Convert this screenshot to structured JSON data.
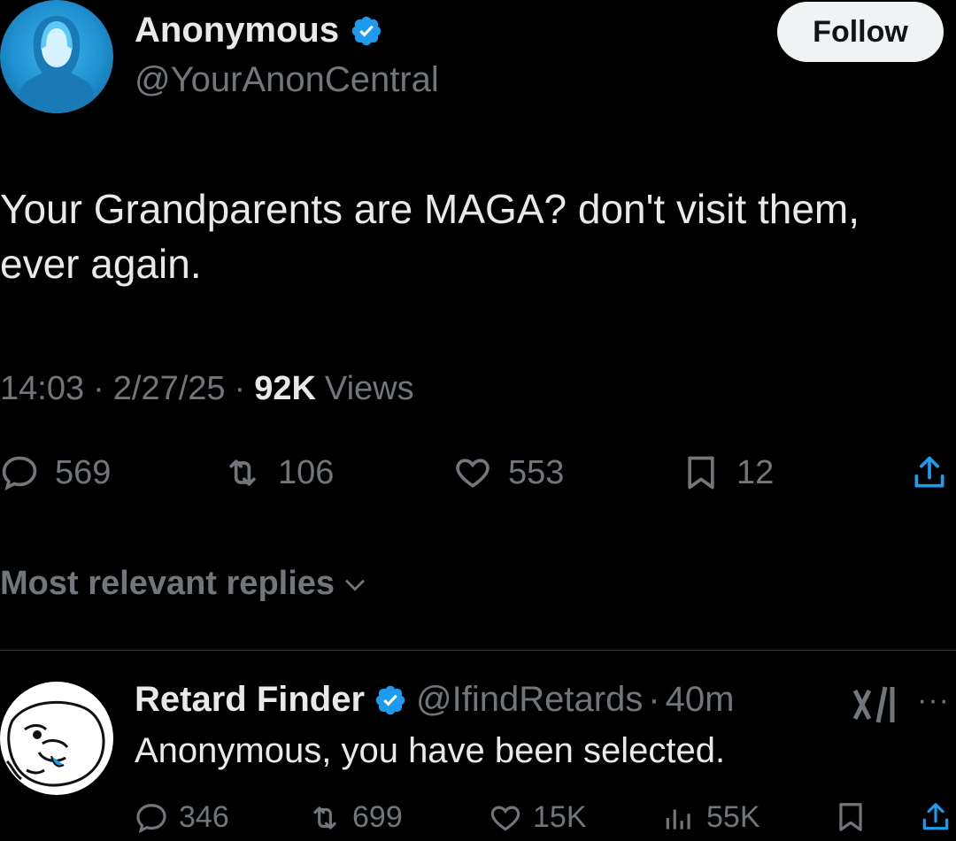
{
  "tweet": {
    "author_name": "Anonymous",
    "author_handle": "@YourAnonCentral",
    "follow_label": "Follow",
    "text_line1": "Your Grandparents are MAGA? don't visit them,",
    "text_line2": "ever again.",
    "time": "14:03",
    "date": "2/27/25",
    "separator": "·",
    "views_count": "92K",
    "views_label": "Views",
    "stats": {
      "replies": "569",
      "reposts": "106",
      "likes": "553",
      "bookmarks": "12"
    }
  },
  "replies_section": {
    "title": "Most relevant replies"
  },
  "reply": {
    "author_name": "Retard Finder",
    "author_handle": "@IfindRetards",
    "separator": "·",
    "age": "40m",
    "text": "Anonymous, you have been selected.",
    "more_label": "···",
    "stats": {
      "replies": "346",
      "reposts": "699",
      "likes": "15K",
      "views": "55K"
    }
  },
  "colors": {
    "background": "#000000",
    "text_primary": "#e7e9ea",
    "text_secondary": "#71767b",
    "verified_blue": "#1d9bf0",
    "follow_bg": "#eff3f4"
  },
  "icons": [
    "verified-badge-icon",
    "reply-icon",
    "repost-icon",
    "like-icon",
    "bookmark-icon",
    "share-icon",
    "chevron-down-icon",
    "grok-icon",
    "views-icon",
    "more-icon"
  ]
}
